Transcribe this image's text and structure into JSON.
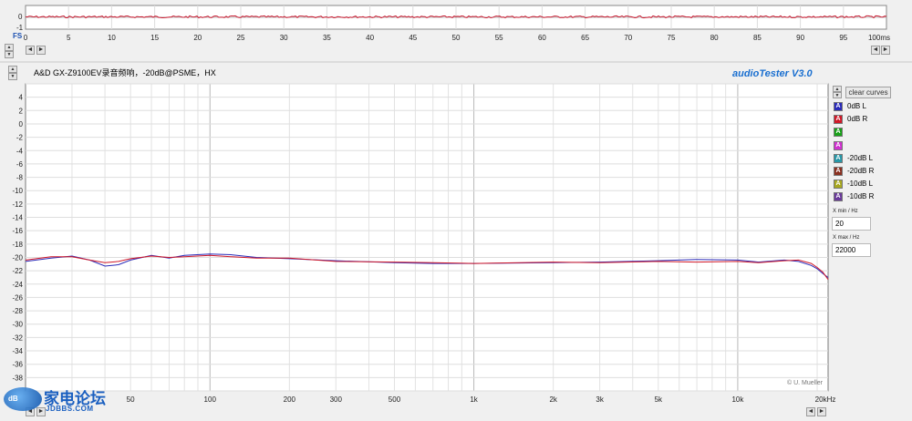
{
  "colors": {
    "blue": "#2a2ab8",
    "red": "#d01828",
    "green": "#18a018",
    "magenta": "#d030d0",
    "teal": "#2898a8",
    "brown": "#8a3020",
    "olive": "#a8a820",
    "purple": "#6a3a9a",
    "brand": "#1a6fd0"
  },
  "top_scope": {
    "fs_label": "FS",
    "y_labels": [
      "0",
      "-1"
    ],
    "time_ticks": [
      "0",
      "5",
      "10",
      "15",
      "20",
      "25",
      "30",
      "35",
      "40",
      "45",
      "50",
      "55",
      "60",
      "65",
      "70",
      "75",
      "80",
      "85",
      "90",
      "95",
      "100ms"
    ]
  },
  "header": {
    "caption": "A&D GX-Z9100EV录音频响，-20dB@PSME，HX",
    "brand": "audioTester  V3.0"
  },
  "chart_data": {
    "type": "line",
    "xlabel": "",
    "ylabel": "",
    "x_scale": "log",
    "xlim": [
      20,
      22000
    ],
    "ylim": [
      -40,
      6
    ],
    "grid": true,
    "y_ticks": [
      4,
      2,
      0,
      -2,
      -4,
      -6,
      -8,
      -10,
      -12,
      -14,
      -16,
      -18,
      -20,
      -22,
      -24,
      -26,
      -28,
      -30,
      -32,
      -34,
      -36,
      -38
    ],
    "y_tick_labels": [
      "4",
      "2",
      "0",
      "-2",
      "-4",
      "-6",
      "-8",
      "-10",
      "-12",
      "-14",
      "-16",
      "-18",
      "-20",
      "-22",
      "-24",
      "-26",
      "-28",
      "-30",
      "-32",
      "-34",
      "-36",
      "-38"
    ],
    "x_ticks": [
      50,
      100,
      200,
      300,
      500,
      1000,
      2000,
      3000,
      5000,
      10000,
      20000
    ],
    "x_tick_labels": [
      "50",
      "100",
      "200",
      "300",
      "500",
      "1k",
      "2k",
      "3k",
      "5k",
      "10k",
      "20kHz"
    ],
    "series": [
      {
        "name": "-20dB L",
        "color": "#2a2ab8",
        "x": [
          20,
          25,
          30,
          35,
          40,
          45,
          50,
          60,
          70,
          80,
          100,
          120,
          150,
          200,
          300,
          500,
          700,
          1000,
          2000,
          3000,
          5000,
          7000,
          10000,
          12000,
          15000,
          17000,
          19000,
          20000,
          21000,
          22000
        ],
        "y": [
          -20.6,
          -20.1,
          -19.8,
          -20.4,
          -21.3,
          -21.1,
          -20.4,
          -19.7,
          -20.1,
          -19.7,
          -19.5,
          -19.6,
          -20.0,
          -20.2,
          -20.5,
          -20.8,
          -20.9,
          -20.9,
          -20.8,
          -20.7,
          -20.5,
          -20.3,
          -20.4,
          -20.7,
          -20.4,
          -20.6,
          -21.2,
          -21.7,
          -22.4,
          -23.0
        ]
      },
      {
        "name": "-20dB R",
        "color": "#d01828",
        "x": [
          20,
          25,
          30,
          35,
          40,
          45,
          50,
          60,
          70,
          80,
          100,
          120,
          150,
          200,
          300,
          500,
          700,
          1000,
          2000,
          3000,
          5000,
          7000,
          10000,
          12000,
          15000,
          17000,
          19000,
          20000,
          21000,
          22000
        ],
        "y": [
          -20.4,
          -19.9,
          -19.9,
          -20.4,
          -20.8,
          -20.6,
          -20.2,
          -19.8,
          -20.0,
          -19.9,
          -19.7,
          -19.9,
          -20.1,
          -20.1,
          -20.6,
          -20.7,
          -20.8,
          -20.9,
          -20.7,
          -20.8,
          -20.6,
          -20.7,
          -20.6,
          -20.8,
          -20.5,
          -20.4,
          -20.9,
          -21.5,
          -22.2,
          -23.3
        ]
      }
    ]
  },
  "legend": {
    "clear_label": "clear curves",
    "items": [
      {
        "chip": "A",
        "label": "0dB L",
        "color": "#2a2ab8"
      },
      {
        "chip": "A",
        "label": "0dB R",
        "color": "#d01828"
      },
      {
        "chip": "A",
        "label": "",
        "color": "#18a018"
      },
      {
        "chip": "A",
        "label": "",
        "color": "#d030d0"
      },
      {
        "chip": "A",
        "label": "-20dB L",
        "color": "#2898a8"
      },
      {
        "chip": "A",
        "label": "-20dB R",
        "color": "#8a3020"
      },
      {
        "chip": "A",
        "label": "-10dB L",
        "color": "#a8a820"
      },
      {
        "chip": "A",
        "label": "-10dB R",
        "color": "#6a3a9a"
      }
    ]
  },
  "xrange": {
    "min_label": "X min / Hz",
    "min_value": "20",
    "max_label": "X max / Hz",
    "max_value": "22000"
  },
  "copyright": "© U. Mueller",
  "watermark": {
    "cn": "家电论坛",
    "en": "JDBBS.COM",
    "small": "dB"
  },
  "glyphs": {
    "up": "▲",
    "down": "▼",
    "left": "◄",
    "right": "►"
  }
}
